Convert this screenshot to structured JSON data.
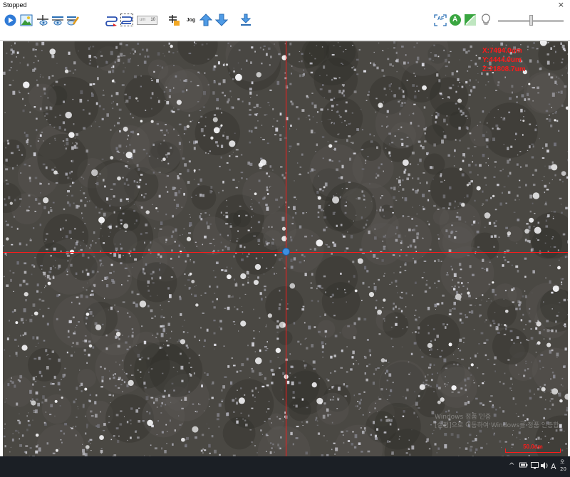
{
  "window": {
    "title": "Stopped",
    "close_glyph": "×"
  },
  "toolbar": {
    "buttons": [
      {
        "name": "run-button",
        "icon": "play-icon"
      },
      {
        "name": "image-button",
        "icon": "image-icon"
      },
      {
        "name": "focus-up-button",
        "icon": "eye-focus-up-icon"
      },
      {
        "name": "focus-down-button",
        "icon": "eye-focus-down-icon"
      },
      {
        "name": "focus-edit-button",
        "icon": "eye-edit-icon"
      },
      {
        "name": "route-button",
        "icon": "route-icon"
      },
      {
        "name": "route-select-button",
        "icon": "route-select-icon"
      },
      {
        "name": "level-button",
        "icon": "level-icon"
      },
      {
        "name": "up-arrow-button",
        "icon": "arrow-up-icon"
      },
      {
        "name": "down-arrow-button",
        "icon": "arrow-down-icon"
      },
      {
        "name": "download-button",
        "icon": "download-icon"
      },
      {
        "name": "af-button",
        "icon": "af-icon"
      },
      {
        "name": "auto-button",
        "icon": "auto-icon"
      },
      {
        "name": "contrast-button",
        "icon": "contrast-icon"
      },
      {
        "name": "lamp-button",
        "icon": "bulb-icon"
      }
    ],
    "step_unit": "um",
    "step_value": "10",
    "jog_label": "Jog",
    "af_label": "AF",
    "auto_label": "A",
    "slider_level": 0.5
  },
  "viewer": {
    "readout": {
      "x": "X:7494.0um",
      "y": "Y:4444.0um",
      "z": "Z:21808.7um"
    },
    "scale_label": "50.0um",
    "watermark_line1": "Windows 정품 인증",
    "watermark_line2": "[설정]으로 이동하여 Windows를 정품 인증합"
  },
  "taskbar": {
    "tray_up": "^",
    "ime_label": "A",
    "clock_line1": "오",
    "clock_line2": "20"
  },
  "colors": {
    "crosshair": "#ff1a1a",
    "accent": "#3d8fe0",
    "taskbar": "#1b1f25"
  }
}
